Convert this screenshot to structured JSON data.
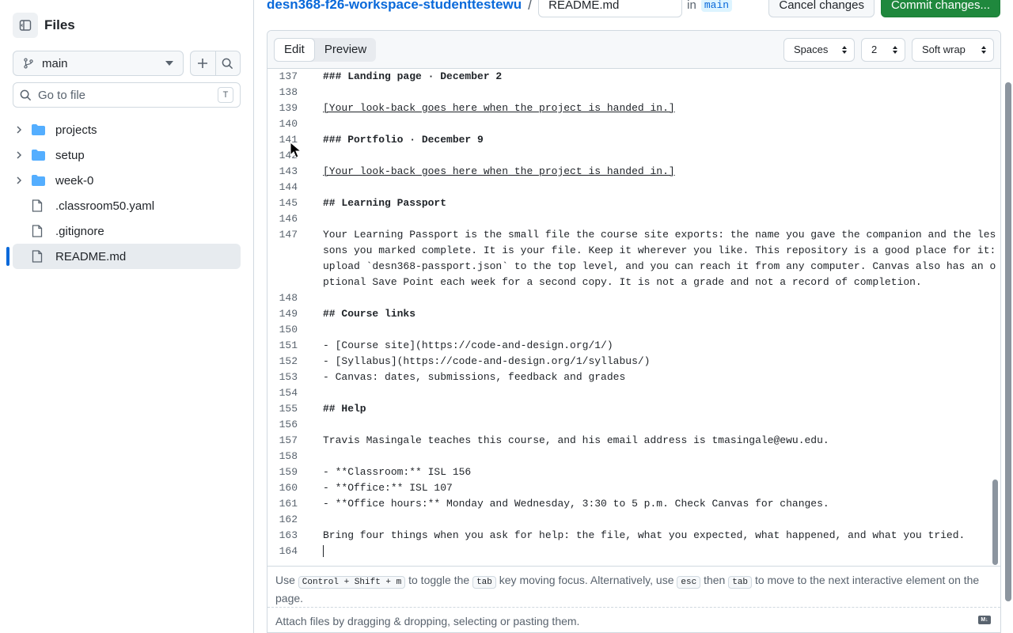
{
  "sidebar": {
    "title": "Files",
    "branch": "main",
    "goto_placeholder": "Go to file",
    "goto_shortcut": "T",
    "items": [
      {
        "name": "projects",
        "type": "folder"
      },
      {
        "name": "setup",
        "type": "folder"
      },
      {
        "name": "week-0",
        "type": "folder"
      },
      {
        "name": ".classroom50.yaml",
        "type": "file"
      },
      {
        "name": ".gitignore",
        "type": "file"
      },
      {
        "name": "README.md",
        "type": "file",
        "active": true
      }
    ]
  },
  "topbar": {
    "repo": "desn368-f26-workspace-studenttestewu",
    "separator": "/",
    "filename": "README.md",
    "in_label": "in",
    "branch": "main",
    "cancel_label": "Cancel changes",
    "commit_label": "Commit changes..."
  },
  "editor": {
    "tabs": {
      "edit": "Edit",
      "preview": "Preview"
    },
    "indent_mode": "Spaces",
    "indent_size": "2",
    "wrap_mode": "Soft wrap",
    "lines": [
      {
        "n": "137",
        "t": "### Landing page · December 2"
      },
      {
        "n": "138",
        "t": ""
      },
      {
        "n": "139",
        "t": "[Your look-back goes here when the project is handed in.]"
      },
      {
        "n": "140",
        "t": ""
      },
      {
        "n": "141",
        "t": "### Portfolio · December 9"
      },
      {
        "n": "142",
        "t": ""
      },
      {
        "n": "143",
        "t": "[Your look-back goes here when the project is handed in.]"
      },
      {
        "n": "144",
        "t": ""
      },
      {
        "n": "145",
        "t": "## Learning Passport"
      },
      {
        "n": "146",
        "t": ""
      },
      {
        "n": "147",
        "t": "Your Learning Passport is the small file the course site exports: the name you gave the companion and the lessons you marked complete. It is your file. Keep it wherever you like. This repository is a good place for it: upload `desn368-passport.json` to the top level, and you can reach it from any computer. Canvas also has an optional Save Point each week for a second copy. It is not a grade and not a record of completion."
      },
      {
        "n": "148",
        "t": ""
      },
      {
        "n": "149",
        "t": "## Course links"
      },
      {
        "n": "150",
        "t": ""
      },
      {
        "n": "151",
        "t": "- [Course site](https://code-and-design.org/1/)"
      },
      {
        "n": "152",
        "t": "- [Syllabus](https://code-and-design.org/1/syllabus/)"
      },
      {
        "n": "153",
        "t": "- Canvas: dates, submissions, feedback and grades"
      },
      {
        "n": "154",
        "t": ""
      },
      {
        "n": "155",
        "t": "## Help"
      },
      {
        "n": "156",
        "t": ""
      },
      {
        "n": "157",
        "t": "Travis Masingale teaches this course, and his email address is tmasingale@ewu.edu."
      },
      {
        "n": "158",
        "t": ""
      },
      {
        "n": "159",
        "t": "- **Classroom:** ISL 156"
      },
      {
        "n": "160",
        "t": "- **Office:** ISL 107"
      },
      {
        "n": "161",
        "t": "- **Office hours:** Monday and Wednesday, 3:30 to 5 p.m. Check Canvas for changes."
      },
      {
        "n": "162",
        "t": ""
      },
      {
        "n": "163",
        "t": "Bring four things when you ask for help: the file, what you expected, what happened, and what you tried."
      },
      {
        "n": "164",
        "t": ""
      }
    ],
    "hint": {
      "use": "Use",
      "shortcut": "Control + Shift + m",
      "toggle": "to toggle the",
      "tab": "tab",
      "moving": "key moving focus. Alternatively, use",
      "esc": "esc",
      "then": "then",
      "tab2": "tab",
      "rest": "to move to the next interactive element on the page."
    },
    "attach_text": "Attach files by dragging & dropping, selecting or pasting them."
  },
  "colors": {
    "accent": "#0969da",
    "commit": "#1f883d",
    "border": "#d1d9e0"
  }
}
